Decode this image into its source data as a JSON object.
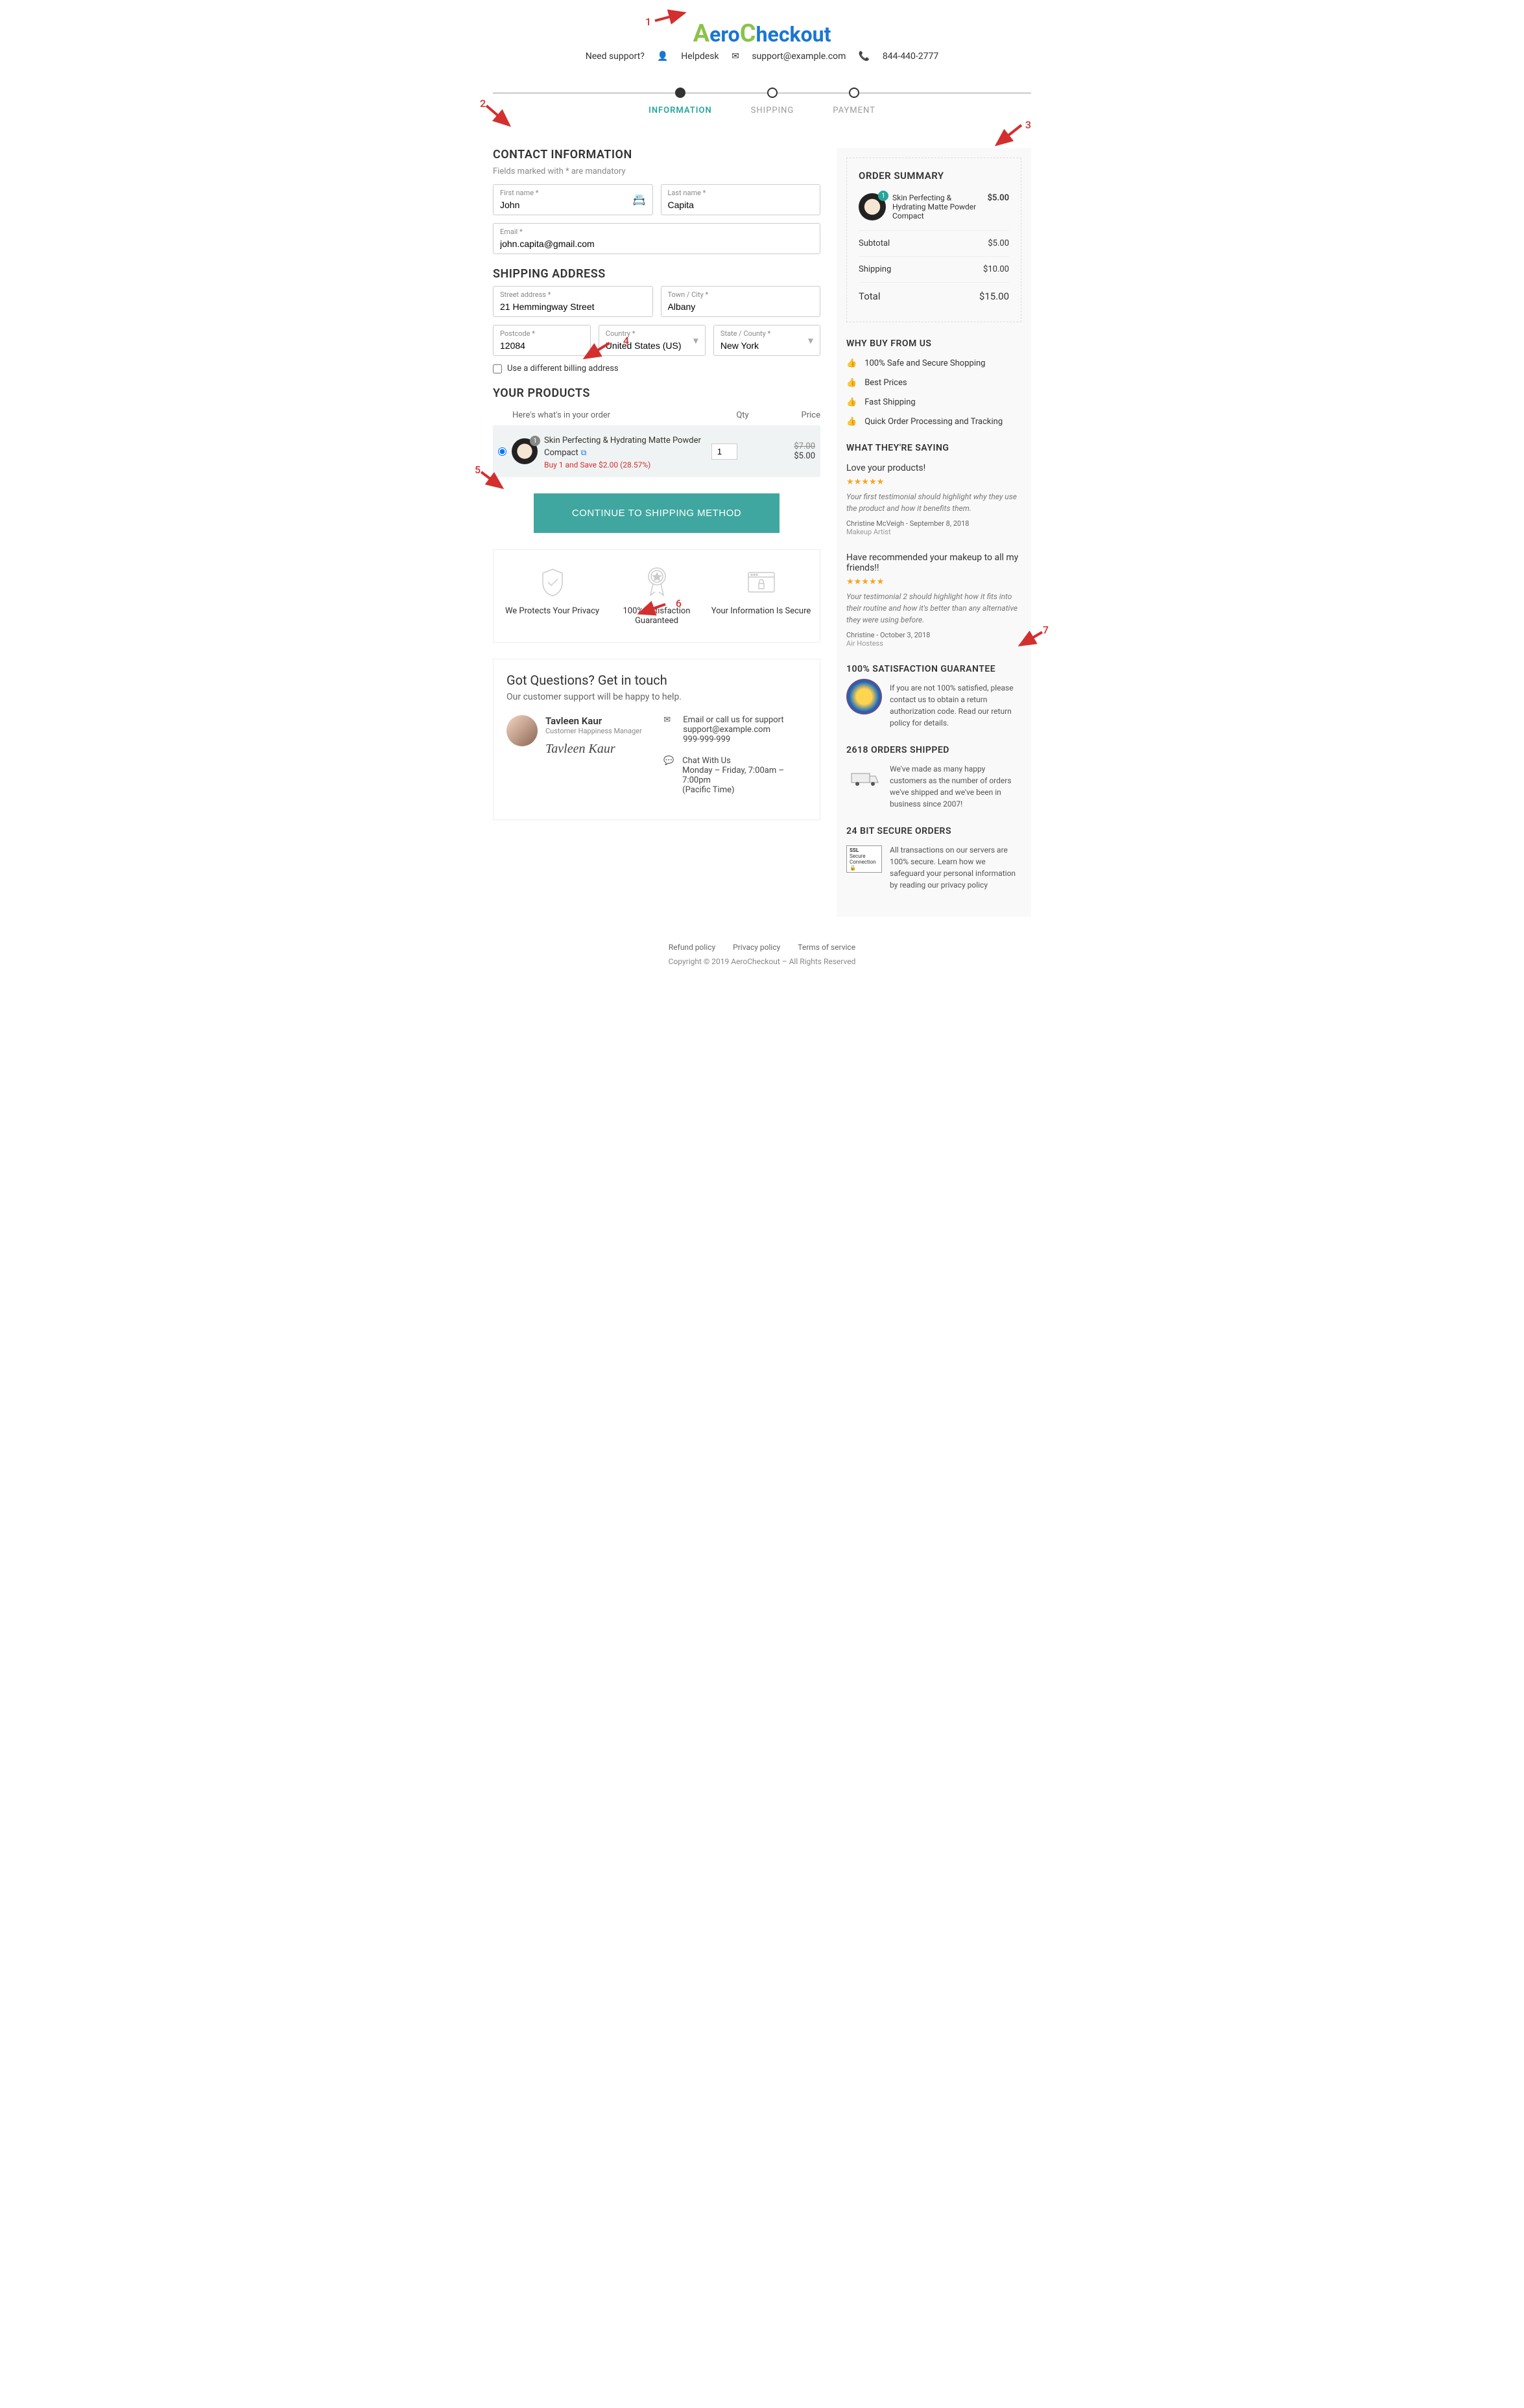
{
  "logo": {
    "a": "A",
    "ero": "ero",
    "c": "C",
    "heckout": "heckout"
  },
  "support": {
    "need": "Need support?",
    "helpdesk": "Helpdesk",
    "email": "support@example.com",
    "phone": "844-440-2777"
  },
  "steps": [
    {
      "label": "INFORMATION",
      "active": true
    },
    {
      "label": "SHIPPING",
      "active": false
    },
    {
      "label": "PAYMENT",
      "active": false
    }
  ],
  "contact": {
    "title": "CONTACT INFORMATION",
    "sub": "Fields marked with * are mandatory",
    "fields": {
      "first_label": "First name *",
      "first_val": "John",
      "last_label": "Last name *",
      "last_val": "Capita",
      "email_label": "Email *",
      "email_val": "john.capita@gmail.com"
    }
  },
  "shipping": {
    "title": "SHIPPING ADDRESS",
    "fields": {
      "street_label": "Street address *",
      "street_val": "21 Hemmingway Street",
      "city_label": "Town / City *",
      "city_val": "Albany",
      "postcode_label": "Postcode *",
      "postcode_val": "12084",
      "country_label": "Country *",
      "country_val": "United States (US)",
      "state_label": "State / County *",
      "state_val": "New York"
    },
    "billing_check": "Use a different billing address"
  },
  "products": {
    "title": "YOUR PRODUCTS",
    "sub": "Here's what's in your order",
    "headers": {
      "qty": "Qty",
      "price": "Price"
    },
    "item": {
      "name": "Skin Perfecting & Hydrating Matte Powder Compact",
      "badge": "1",
      "promo": "Buy 1 and Save $2.00 (28.57%)",
      "qty": "1",
      "price_old": "$7.00",
      "price_new": "$5.00"
    },
    "continue": "CONTINUE TO SHIPPING METHOD"
  },
  "trust": [
    {
      "text": "We Protects Your Privacy"
    },
    {
      "text": "100% Satisfaction Guaranteed"
    },
    {
      "text": "Your Information Is Secure"
    }
  ],
  "contact_box": {
    "title": "Got Questions? Get in touch",
    "sub": "Our customer support will be happy to help.",
    "person": {
      "name": "Tavleen Kaur",
      "role": "Customer Happiness Manager",
      "signature": "Tavleen Kaur"
    },
    "methods": [
      {
        "title": "Email or call us for support",
        "line1": "support@example.com",
        "line2": "999-999-999"
      },
      {
        "title": "Chat With Us",
        "line1": "Monday – Friday, 7:00am – 7:00pm",
        "line2": "(Pacific Time)"
      }
    ]
  },
  "summary": {
    "title": "ORDER SUMMARY",
    "item": {
      "name": "Skin Perfecting & Hydrating Matte Powder Compact",
      "badge": "1",
      "price": "$5.00"
    },
    "subtotal_label": "Subtotal",
    "subtotal_val": "$5.00",
    "shipping_label": "Shipping",
    "shipping_val": "$10.00",
    "total_label": "Total",
    "total_val": "$15.00"
  },
  "why": {
    "title": "WHY BUY FROM US",
    "items": [
      "100% Safe and Secure Shopping",
      "Best Prices",
      "Fast Shipping",
      "Quick Order Processing and Tracking"
    ]
  },
  "testimonials": {
    "title": "WHAT THEY'RE SAYING",
    "items": [
      {
        "heading": "Love your products!",
        "text": "Your first testimonial should highlight why they use the product and how it benefits them.",
        "author": "Christine McVeigh",
        "date": "September 8, 2018",
        "role": "Makeup Artist"
      },
      {
        "heading": "Have recommended your makeup to all my friends!!",
        "text": "Your testimonial 2 should highlight how it fits into their routine and how it's better than any alternative they were using before.",
        "author": "Christine",
        "date": "October 3, 2018",
        "role": "Air Hostess"
      }
    ]
  },
  "guarantee": {
    "title": "100% SATISFACTION GUARANTEE",
    "text": "If you are not 100% satisfied, please contact us to obtain a return authorization code. Read our return policy for details."
  },
  "orders": {
    "title": "2618 ORDERS SHIPPED",
    "text": "We've made as many happy customers as the number of orders we've shipped and we've been in business since 2007!"
  },
  "secure": {
    "title": "24 BIT SECURE ORDERS",
    "text": "All transactions on our servers are 100% secure. Learn how we safeguard your personal information by reading our privacy policy"
  },
  "footer": {
    "links": [
      "Refund policy",
      "Privacy policy",
      "Terms of service"
    ],
    "copyright": "Copyright © 2019 AeroCheckout – All Rights Reserved"
  },
  "annotations": [
    "1",
    "2",
    "3",
    "4",
    "5",
    "6",
    "7"
  ]
}
